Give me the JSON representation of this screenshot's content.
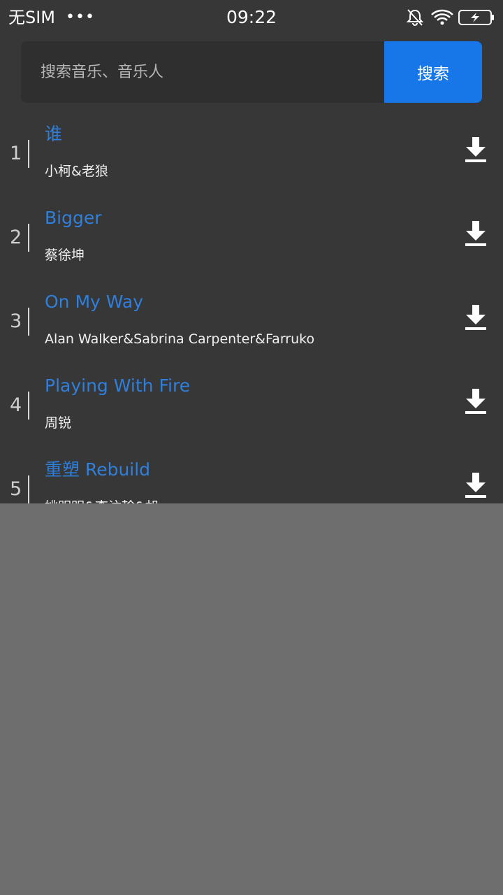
{
  "status_bar": {
    "carrier": "无SIM",
    "dots": "•••",
    "time": "09:22",
    "icons": [
      "bell-muted-icon",
      "wifi-icon",
      "battery-charging-icon"
    ]
  },
  "search": {
    "placeholder": "搜索音乐、音乐人",
    "button_label": "搜索"
  },
  "colors": {
    "background": "#373737",
    "accent": "#1877e8",
    "title_blue": "#2f7fdc",
    "overlay": "#6e6e6e"
  },
  "songs": [
    {
      "index": "1",
      "title": "谁",
      "artist": "小柯&老狼"
    },
    {
      "index": "2",
      "title": "Bigger",
      "artist": "蔡徐坤"
    },
    {
      "index": "3",
      "title": "On My Way",
      "artist": "Alan Walker&Sabrina Carpenter&Farruko"
    },
    {
      "index": "4",
      "title": "Playing With Fire",
      "artist": "周锐"
    },
    {
      "index": "5",
      "title": "重塑 Rebuild",
      "artist": "姚明明&李汶翰&胡"
    }
  ]
}
